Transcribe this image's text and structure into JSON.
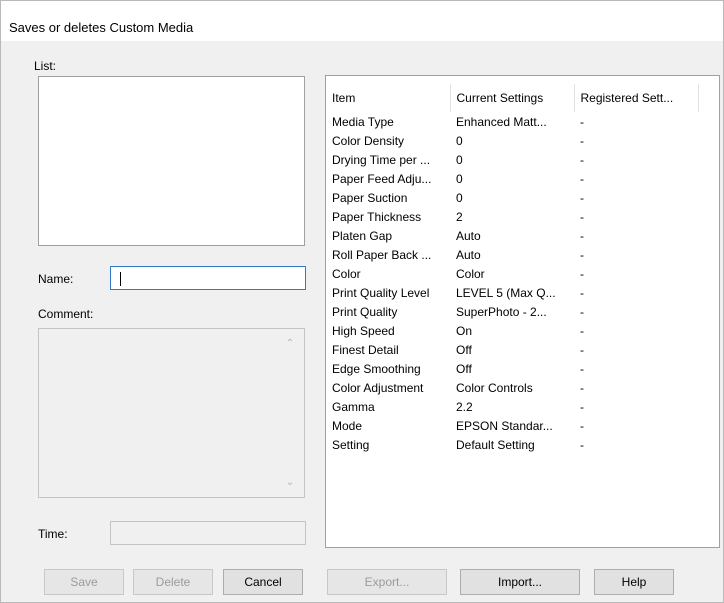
{
  "window": {
    "title": "Saves or deletes Custom Media"
  },
  "left_panel": {
    "list_label": "List:",
    "name_label": "Name:",
    "name_value": "",
    "comment_label": "Comment:",
    "time_label": "Time:",
    "time_value": ""
  },
  "settings_table": {
    "headers": [
      "Item",
      "Current Settings",
      "Registered Sett..."
    ],
    "rows": [
      [
        "Media Type",
        "Enhanced Matt...",
        "-"
      ],
      [
        "Color Density",
        "0",
        "-"
      ],
      [
        "Drying Time per ...",
        "0",
        "-"
      ],
      [
        "Paper Feed Adju...",
        "0",
        "-"
      ],
      [
        "Paper Suction",
        "0",
        "-"
      ],
      [
        "Paper Thickness",
        "2",
        "-"
      ],
      [
        "Platen Gap",
        "Auto",
        "-"
      ],
      [
        "Roll Paper Back ...",
        "Auto",
        "-"
      ],
      [
        "Color",
        "Color",
        "-"
      ],
      [
        "Print Quality Level",
        "LEVEL 5 (Max Q...",
        "-"
      ],
      [
        "Print Quality",
        "SuperPhoto - 2...",
        "-"
      ],
      [
        "High Speed",
        "On",
        "-"
      ],
      [
        "Finest Detail",
        "Off",
        "-"
      ],
      [
        "Edge Smoothing",
        "Off",
        "-"
      ],
      [
        "Color Adjustment",
        "Color Controls",
        "-"
      ],
      [
        "Gamma",
        "2.2",
        "-"
      ],
      [
        "Mode",
        "EPSON Standar...",
        "-"
      ],
      [
        "Setting",
        "Default Setting",
        "-"
      ]
    ]
  },
  "buttons": {
    "save": "Save",
    "delete": "Delete",
    "cancel": "Cancel",
    "export": "Export...",
    "import": "Import...",
    "help": "Help"
  },
  "icons": {
    "scroll_up": "chevron-up-icon",
    "scroll_down": "chevron-down-icon"
  }
}
